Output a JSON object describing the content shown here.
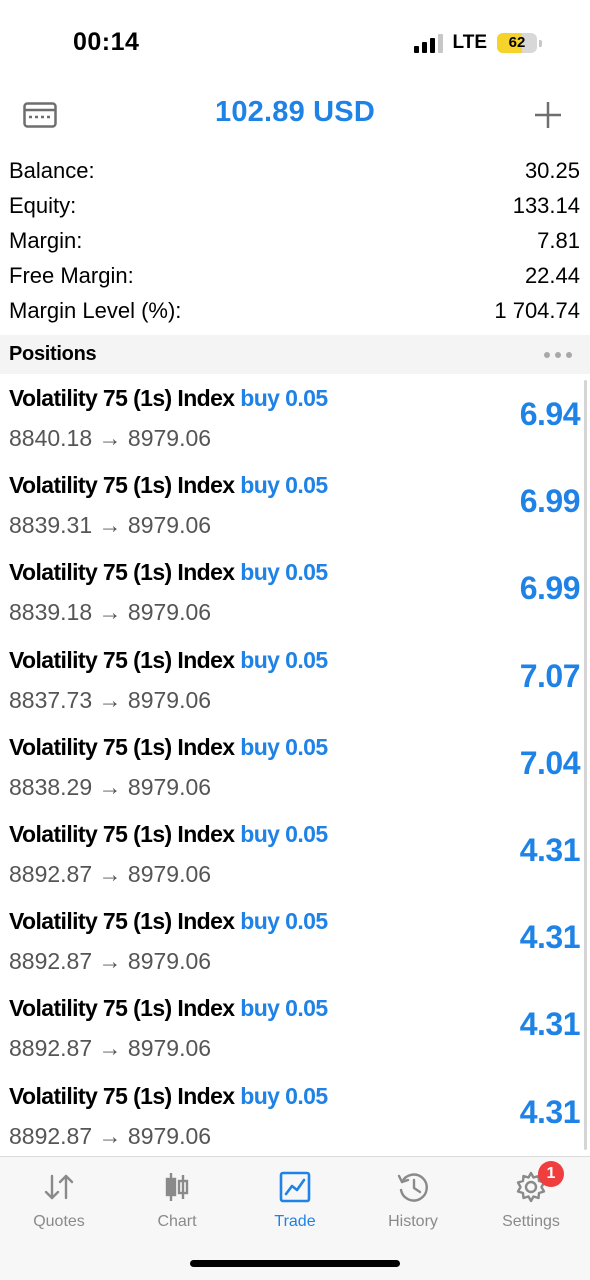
{
  "status": {
    "time": "00:14",
    "network": "LTE",
    "battery": "62",
    "battery_pct": 62
  },
  "header": {
    "title": "102.89 USD"
  },
  "summary": [
    {
      "label": "Balance:",
      "value": "30.25"
    },
    {
      "label": "Equity:",
      "value": "133.14"
    },
    {
      "label": "Margin:",
      "value": "7.81"
    },
    {
      "label": "Free Margin:",
      "value": "22.44"
    },
    {
      "label": "Margin Level (%):",
      "value": "1 704.74"
    }
  ],
  "positions_section": {
    "title": "Positions"
  },
  "positions": [
    {
      "symbol": "Volatility 75 (1s) Index",
      "side": "buy 0.05",
      "prices": "8840.18 → 8979.06",
      "profit": "6.94"
    },
    {
      "symbol": "Volatility 75 (1s) Index",
      "side": "buy 0.05",
      "prices": "8839.31 → 8979.06",
      "profit": "6.99"
    },
    {
      "symbol": "Volatility 75 (1s) Index",
      "side": "buy 0.05",
      "prices": "8839.18 → 8979.06",
      "profit": "6.99"
    },
    {
      "symbol": "Volatility 75 (1s) Index",
      "side": "buy 0.05",
      "prices": "8837.73 → 8979.06",
      "profit": "7.07"
    },
    {
      "symbol": "Volatility 75 (1s) Index",
      "side": "buy 0.05",
      "prices": "8838.29 → 8979.06",
      "profit": "7.04"
    },
    {
      "symbol": "Volatility 75 (1s) Index",
      "side": "buy 0.05",
      "prices": "8892.87 → 8979.06",
      "profit": "4.31"
    },
    {
      "symbol": "Volatility 75 (1s) Index",
      "side": "buy 0.05",
      "prices": "8892.87 → 8979.06",
      "profit": "4.31"
    },
    {
      "symbol": "Volatility 75 (1s) Index",
      "side": "buy 0.05",
      "prices": "8892.87 → 8979.06",
      "profit": "4.31"
    },
    {
      "symbol": "Volatility 75 (1s) Index",
      "side": "buy 0.05",
      "prices": "8892.87 → 8979.06",
      "profit": "4.31"
    }
  ],
  "tabs": [
    {
      "label": "Quotes",
      "icon": "quotes-arrows-icon"
    },
    {
      "label": "Chart",
      "icon": "candlestick-icon"
    },
    {
      "label": "Trade",
      "icon": "trade-chart-icon",
      "active": true
    },
    {
      "label": "History",
      "icon": "history-clock-icon"
    },
    {
      "label": "Settings",
      "icon": "gear-icon",
      "badge": "1"
    }
  ],
  "colors": {
    "accent": "#1e82e6",
    "badge": "#f03e3e",
    "battery": "#f6d32b"
  }
}
